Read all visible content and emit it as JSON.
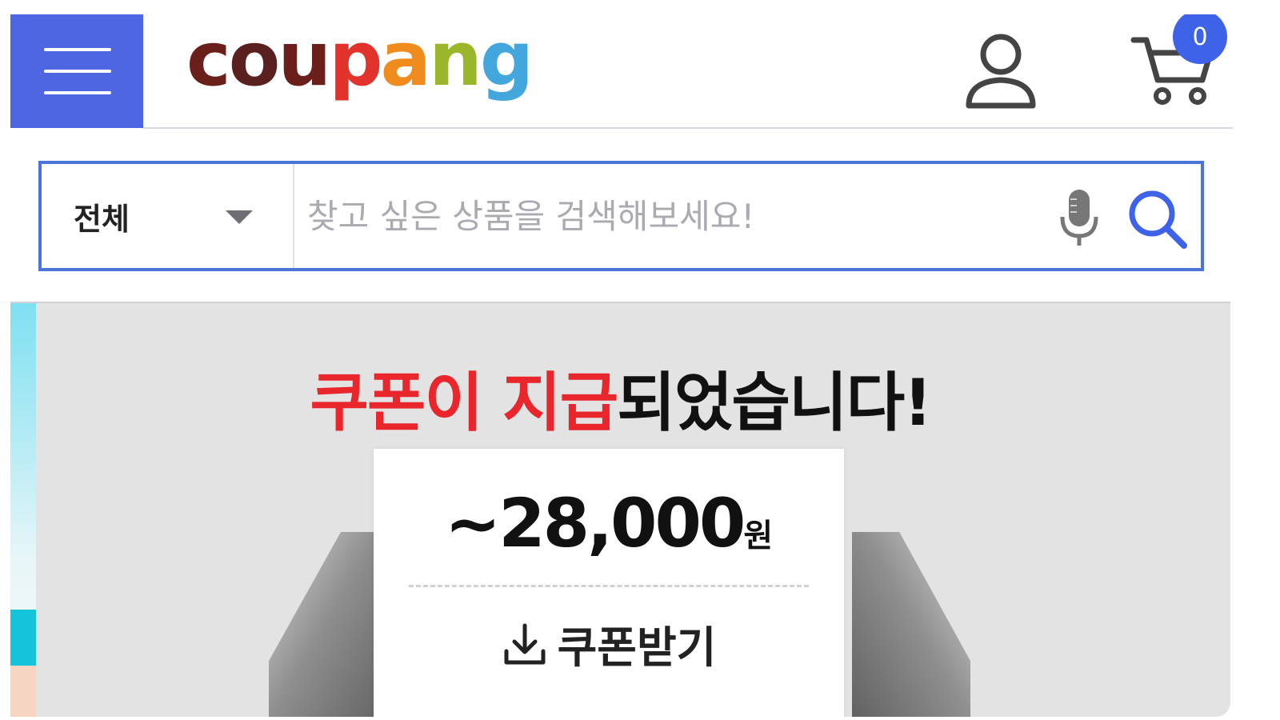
{
  "header": {
    "menu_icon": "hamburger-icon",
    "logo": {
      "text": "coupang",
      "letters": [
        {
          "char": "c",
          "color": "#6b1f1b"
        },
        {
          "char": "o",
          "color": "#5a1f1f"
        },
        {
          "char": "u",
          "color": "#6b1f1b"
        },
        {
          "char": "p",
          "color": "#e2322c"
        },
        {
          "char": "a",
          "color": "#f08c1e"
        },
        {
          "char": "n",
          "color": "#9ab62a"
        },
        {
          "char": "g",
          "color": "#43a7dd"
        }
      ]
    },
    "user_icon": "user-icon",
    "cart_icon": "cart-icon",
    "cart_count": "0"
  },
  "search": {
    "category": "전체",
    "placeholder": "찾고 싶은 상품을 검색해보세요!",
    "value": "",
    "mic_icon": "microphone-icon",
    "search_icon": "search-icon"
  },
  "banner": {
    "title_red": "쿠폰이 지급",
    "title_black": "되었습니다!",
    "coupon_amount": "~28,000",
    "coupon_unit": "원",
    "download_label": "쿠폰받기",
    "download_icon": "download-icon"
  },
  "colors": {
    "brand_blue": "#4f66e3",
    "search_border": "#4a74d8",
    "highlight_red": "#e8262b",
    "badge_blue": "#3f63e8"
  }
}
